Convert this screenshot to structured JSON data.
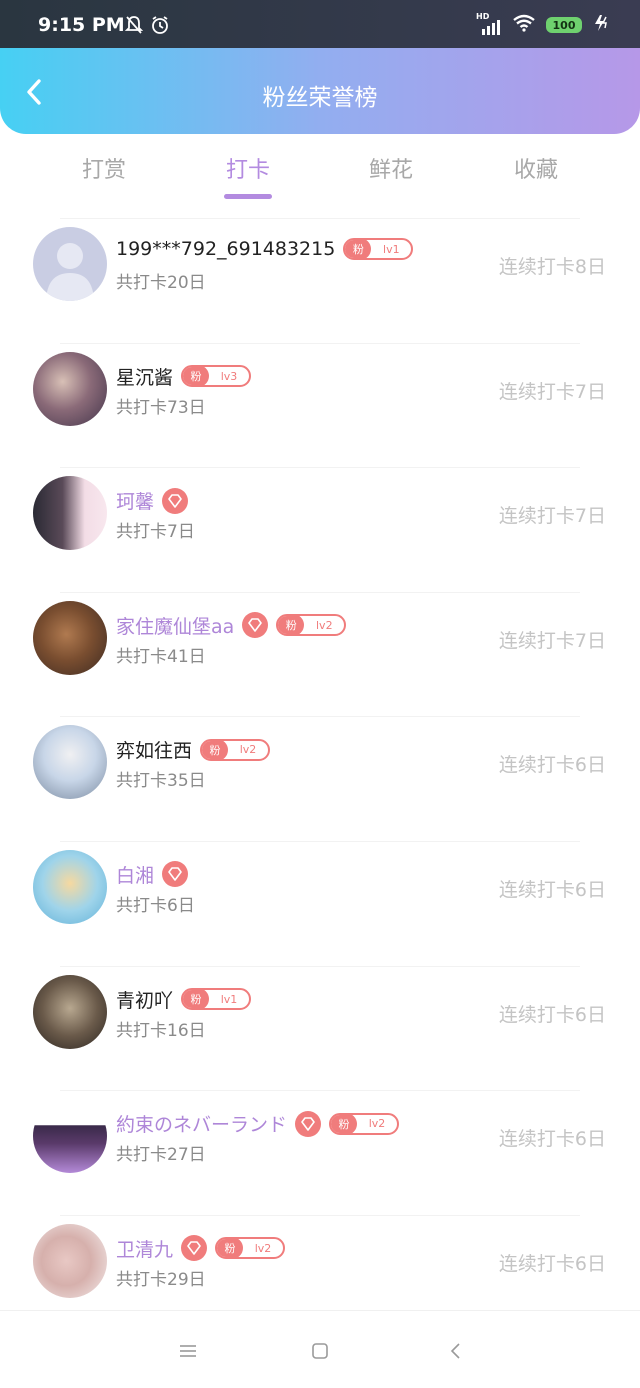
{
  "status_bar": {
    "time": "9:15 PM",
    "battery": "100",
    "network_tag": "HD"
  },
  "header": {
    "title": "粉丝荣誉榜"
  },
  "tabs": [
    {
      "label": "打赏",
      "active": false
    },
    {
      "label": "打卡",
      "active": true
    },
    {
      "label": "鲜花",
      "active": false
    },
    {
      "label": "收藏",
      "active": false
    }
  ],
  "rows": [
    {
      "name": "199***792_691483215",
      "vip": false,
      "fan_badge": {
        "label": "粉",
        "level": "lv1"
      },
      "total": "共打卡20日",
      "streak": "连续打卡8日"
    },
    {
      "name": "星沉酱",
      "vip": false,
      "fan_badge": {
        "label": "粉",
        "level": "lv3"
      },
      "total": "共打卡73日",
      "streak": "连续打卡7日"
    },
    {
      "name": "珂馨",
      "vip": true,
      "fan_badge": null,
      "total": "共打卡7日",
      "streak": "连续打卡7日"
    },
    {
      "name": "家住魔仙堡aa",
      "vip": true,
      "fan_badge": {
        "label": "粉",
        "level": "lv2"
      },
      "total": "共打卡41日",
      "streak": "连续打卡7日"
    },
    {
      "name": "弈如往西",
      "vip": false,
      "fan_badge": {
        "label": "粉",
        "level": "lv2"
      },
      "total": "共打卡35日",
      "streak": "连续打卡6日"
    },
    {
      "name": "白湘",
      "vip": true,
      "fan_badge": null,
      "total": "共打卡6日",
      "streak": "连续打卡6日"
    },
    {
      "name": "青初吖",
      "vip": false,
      "fan_badge": {
        "label": "粉",
        "level": "lv1"
      },
      "total": "共打卡16日",
      "streak": "连续打卡6日"
    },
    {
      "name": "約束のネバーランド",
      "vip": true,
      "fan_badge": {
        "label": "粉",
        "level": "lv2"
      },
      "total": "共打卡27日",
      "streak": "连续打卡6日"
    },
    {
      "name": "卫清九",
      "vip": true,
      "fan_badge": {
        "label": "粉",
        "level": "lv2"
      },
      "total": "共打卡29日",
      "streak": "连续打卡6日"
    }
  ],
  "colors": {
    "accent": "#b38be0",
    "badge": "#f07c7c",
    "vip_name": "#ae86d8"
  }
}
